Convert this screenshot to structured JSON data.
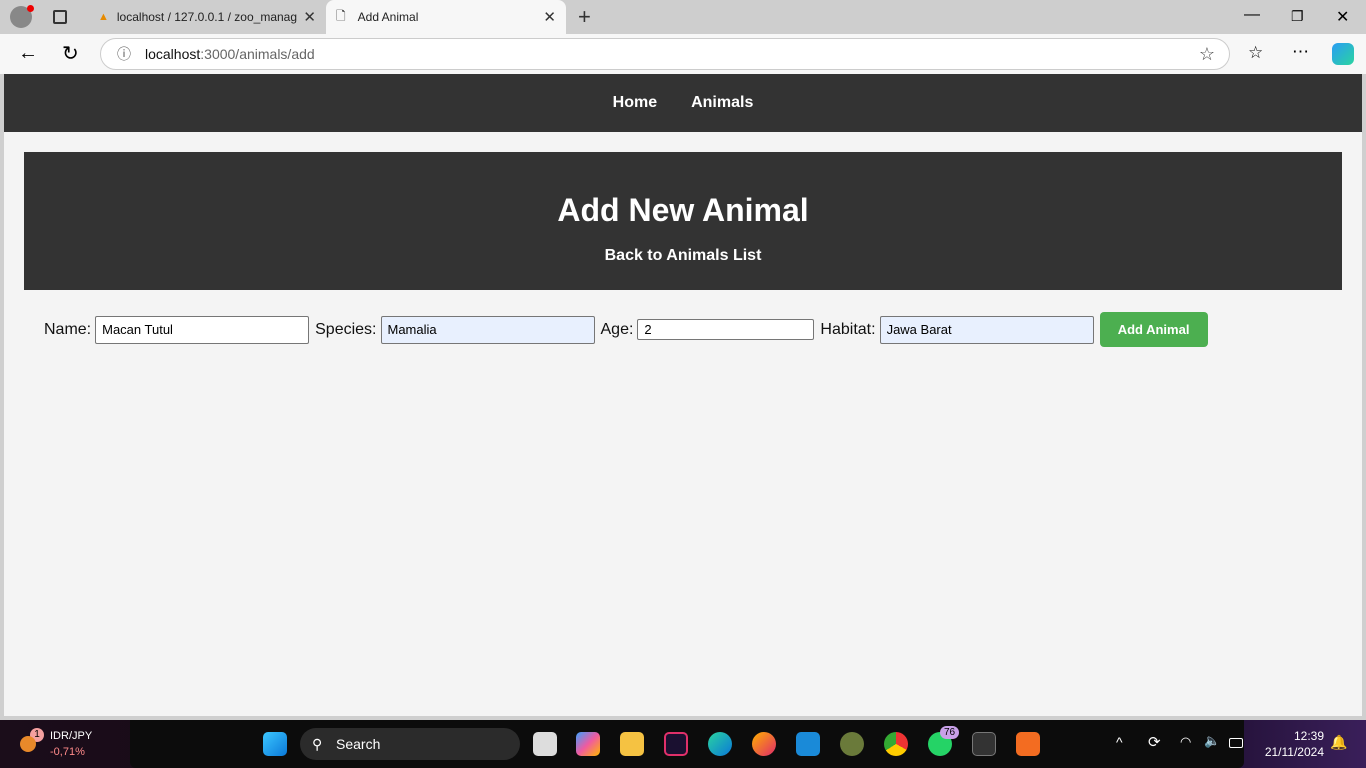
{
  "browser": {
    "tabs": [
      {
        "label": "localhost / 127.0.0.1 / zoo_manag",
        "icon": "phpmyadmin-icon"
      },
      {
        "label": "Add Animal",
        "icon": "page-icon"
      }
    ],
    "url_host": "localhost",
    "url_rest": ":3000/animals/add"
  },
  "nav": {
    "items": [
      "Home",
      "Animals"
    ]
  },
  "hero": {
    "title": "Add New Animal",
    "back_link": "Back to Animals List"
  },
  "form": {
    "name_label": "Name:",
    "name_value": "Macan Tutul",
    "species_label": "Species:",
    "species_value": "Mamalia",
    "age_label": "Age:",
    "age_value": "2",
    "habitat_label": "Habitat:",
    "habitat_value": "Jawa Barat",
    "submit": "Add Animal"
  },
  "taskbar": {
    "widget_badge": "1",
    "widget_title": "IDR/JPY",
    "widget_value": "-0,71%",
    "search": "Search",
    "whatsapp_badge": "76",
    "time": "12:39",
    "date": "21/11/2024"
  },
  "colors": {
    "nav_bg": "#333333",
    "button": "#4caf50",
    "autofill": "#e8f0fe",
    "widget_negative": "#ff8a8a"
  }
}
